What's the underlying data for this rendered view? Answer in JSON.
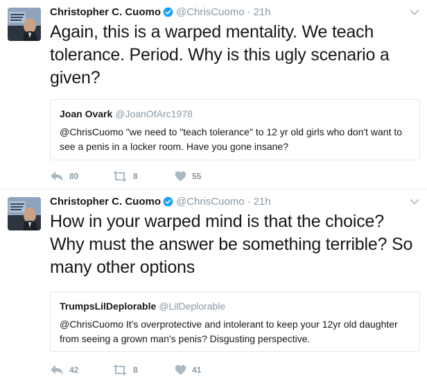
{
  "tweets": [
    {
      "author": {
        "name": "Christopher C. Cuomo",
        "handle": "@ChrisCuomo",
        "time": "21h"
      },
      "text": "Again, this is a warped mentality. We teach tolerance. Period. Why is this ugly scenario a given?",
      "quoted": {
        "name": "Joan Ovark",
        "handle": "@JoanOfArc1978",
        "text": "@ChrisCuomo  \"we need to \"teach tolerance\" to 12 yr old girls who don't want to see a penis in a locker room. Have you gone insane?"
      },
      "stats": {
        "replies": "80",
        "retweets": "8",
        "likes": "55"
      }
    },
    {
      "author": {
        "name": "Christopher C. Cuomo",
        "handle": "@ChrisCuomo",
        "time": "21h"
      },
      "text": "How in your warped mind is that the choice? Why must the answer be something terrible? So many other options",
      "quoted": {
        "name": "TrumpsLilDeplorable",
        "handle": "@LilDeplorable",
        "text": "@ChrisCuomo It's overprotective and intolerant to keep your 12yr old daughter from seeing a grown man's penis? Disgusting perspective."
      },
      "stats": {
        "replies": "42",
        "retweets": "8",
        "likes": "41"
      }
    }
  ],
  "separator": "·",
  "icons": {
    "verified": "verified-badge-icon",
    "caret": "chevron-down-icon",
    "reply": "reply-icon",
    "retweet": "retweet-icon",
    "like": "heart-icon"
  },
  "colors": {
    "verified": "#1da1f2",
    "muted": "#8899a6",
    "border": "#e1e8ed",
    "text": "#14171a"
  }
}
